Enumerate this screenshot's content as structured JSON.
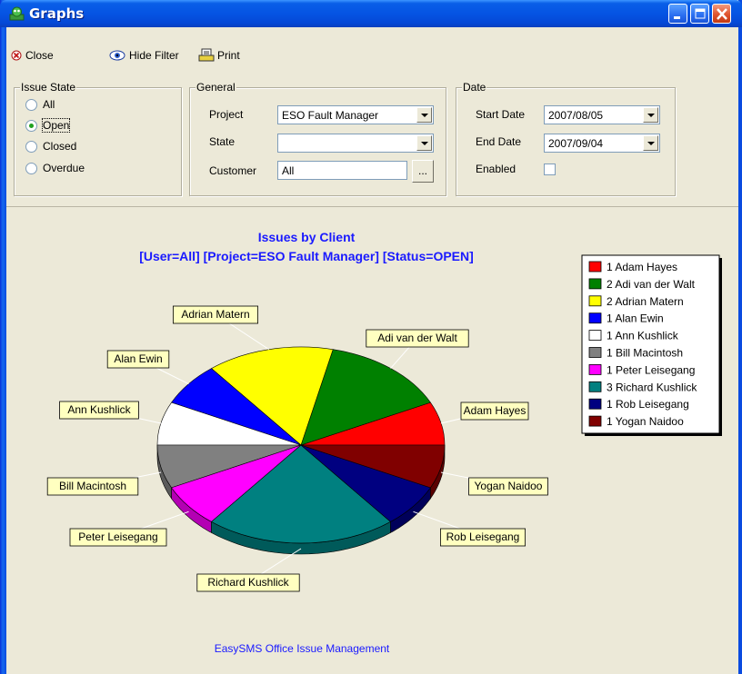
{
  "window": {
    "title": "Graphs"
  },
  "toolbar": {
    "close_label": "Close",
    "hide_filter_label": "Hide Filter",
    "print_label": "Print"
  },
  "issue_state": {
    "title": "Issue State",
    "options": [
      {
        "label": "All",
        "checked": false
      },
      {
        "label": "Open",
        "checked": true
      },
      {
        "label": "Closed",
        "checked": false
      },
      {
        "label": "Overdue",
        "checked": false
      }
    ]
  },
  "general": {
    "title": "General",
    "project_label": "Project",
    "project_value": "ESO Fault Manager",
    "state_label": "State",
    "state_value": "",
    "customer_label": "Customer",
    "customer_value": "All",
    "customer_button": "..."
  },
  "date": {
    "title": "Date",
    "start_label": "Start Date",
    "start_value": "2007/08/05",
    "end_label": "End Date",
    "end_value": "2007/09/04",
    "enabled_label": "Enabled",
    "enabled_checked": false
  },
  "chart_data": {
    "type": "pie",
    "title": "Issues by Client",
    "subtitle": "[User=All] [Project=ESO Fault Manager] [Status=OPEN]",
    "footer": "EasySMS Office Issue Management",
    "legend_position": "right",
    "slices": [
      {
        "label": "Adam Hayes",
        "legend": "1 Adam Hayes",
        "value": 1,
        "color": "#ff0000"
      },
      {
        "label": "Adi van der Walt",
        "legend": "2 Adi van der Walt",
        "value": 2,
        "color": "#008000"
      },
      {
        "label": "Adrian Matern",
        "legend": "2 Adrian Matern",
        "value": 2,
        "color": "#ffff00"
      },
      {
        "label": "Alan Ewin",
        "legend": "1 Alan Ewin",
        "value": 1,
        "color": "#0000ff"
      },
      {
        "label": "Ann Kushlick",
        "legend": "1 Ann Kushlick",
        "value": 1,
        "color": "#ffffff"
      },
      {
        "label": "Bill Macintosh",
        "legend": "1 Bill Macintosh",
        "value": 1,
        "color": "#808080"
      },
      {
        "label": "Peter Leisegang",
        "legend": "1 Peter Leisegang",
        "value": 1,
        "color": "#ff00ff"
      },
      {
        "label": "Richard Kushlick",
        "legend": "3 Richard Kushlick",
        "value": 3,
        "color": "#008080"
      },
      {
        "label": "Rob Leisegang",
        "legend": "1 Rob Leisegang",
        "value": 1,
        "color": "#000080"
      },
      {
        "label": "Yogan Naidoo",
        "legend": "1 Yogan Naidoo",
        "value": 1,
        "color": "#800000"
      }
    ]
  }
}
